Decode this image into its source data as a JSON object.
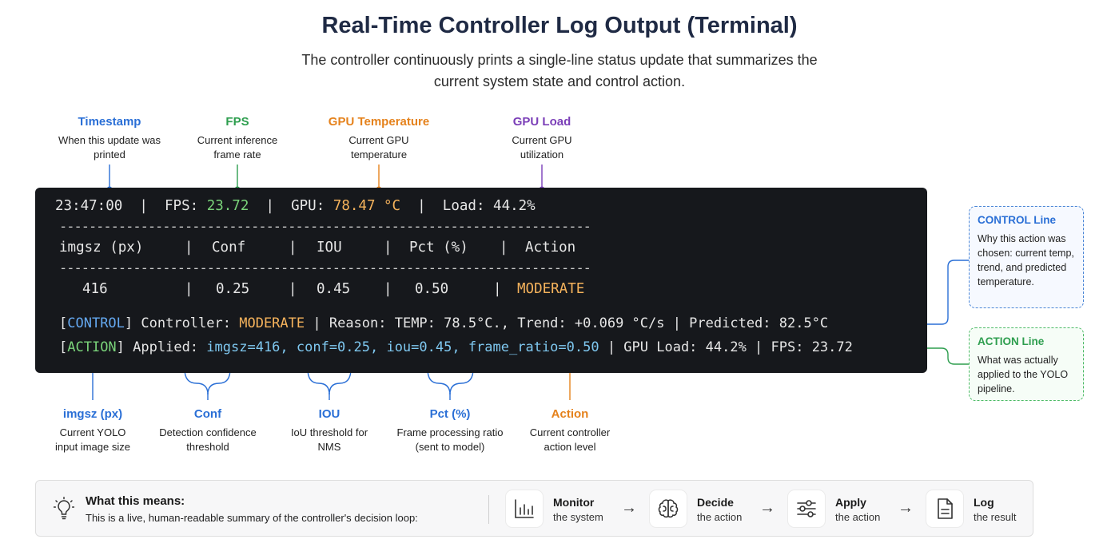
{
  "header": {
    "title": "Real-Time Controller Log Output (Terminal)",
    "subtitle": "The controller continuously prints a single-line status update that summarizes the current system state and control action."
  },
  "top_labels": [
    {
      "title": "Timestamp",
      "desc": "When this update was printed",
      "color": "#2a6fd6"
    },
    {
      "title": "FPS",
      "desc": "Current inference frame rate",
      "color": "#2e9e4f"
    },
    {
      "title": "GPU Temperature",
      "desc": "Current GPU temperature",
      "color": "#e5821c"
    },
    {
      "title": "GPU Load",
      "desc": "Current GPU utilization",
      "color": "#7b3fb8"
    }
  ],
  "terminal": {
    "status": {
      "time": "23:47:00",
      "sep": "|",
      "fps_label": "FPS:",
      "fps_value": "23.72",
      "gpu_label": "GPU:",
      "gpu_value": "78.47 °C",
      "load_label": "Load:",
      "load_value": "44.2%"
    },
    "dashes": "-----------------------------------------------------------------------------------------",
    "headers": [
      "imgsz (px)",
      "Conf",
      "IOU",
      "Pct (%)",
      "Action"
    ],
    "values": [
      "416",
      "0.25",
      "0.45",
      "0.50",
      "MODERATE"
    ],
    "control_line": {
      "tag": "CONTROL",
      "controller_label": "Controller:",
      "controller_value": "MODERATE",
      "rest": "| Reason: TEMP: 78.5°C., Trend: +0.069 °C/s | Predicted: 82.5°C"
    },
    "action_line": {
      "tag": "ACTION",
      "applied_label": "Applied:",
      "params": "imgsz=416, conf=0.25, iou=0.45, frame_ratio=0.50",
      "rest": "| GPU Load: 44.2% | FPS: 23.72"
    }
  },
  "bottom_labels": [
    {
      "title": "imgsz (px)",
      "desc": "Current YOLO input image size",
      "color": "#2a6fd6"
    },
    {
      "title": "Conf",
      "desc": "Detection confidence threshold",
      "color": "#2a6fd6"
    },
    {
      "title": "IOU",
      "desc": "IoU threshold for NMS",
      "color": "#2a6fd6"
    },
    {
      "title": "Pct (%)",
      "desc": "Frame processing ratio (sent to model)",
      "color": "#2a6fd6"
    },
    {
      "title": "Action",
      "desc": "Current controller action level",
      "color": "#e5821c"
    }
  ],
  "side_boxes": {
    "control": {
      "title": "CONTROL Line",
      "desc": "Why this action was chosen: current temp, trend, and predicted temperature.",
      "color": "#2a6fd6"
    },
    "action": {
      "title": "ACTION Line",
      "desc": "What was actually applied to the YOLO pipeline.",
      "color": "#2e9e4f"
    }
  },
  "meaning": {
    "title": "What this means:",
    "desc": "This is a live, human-readable summary of the controller's decision loop:",
    "steps": [
      {
        "title": "Monitor",
        "sub": "the system",
        "icon": "bar-chart-icon"
      },
      {
        "title": "Decide",
        "sub": "the action",
        "icon": "brain-icon"
      },
      {
        "title": "Apply",
        "sub": "the action",
        "icon": "sliders-icon"
      },
      {
        "title": "Log",
        "sub": "the result",
        "icon": "document-icon"
      }
    ],
    "arrow": "→"
  }
}
